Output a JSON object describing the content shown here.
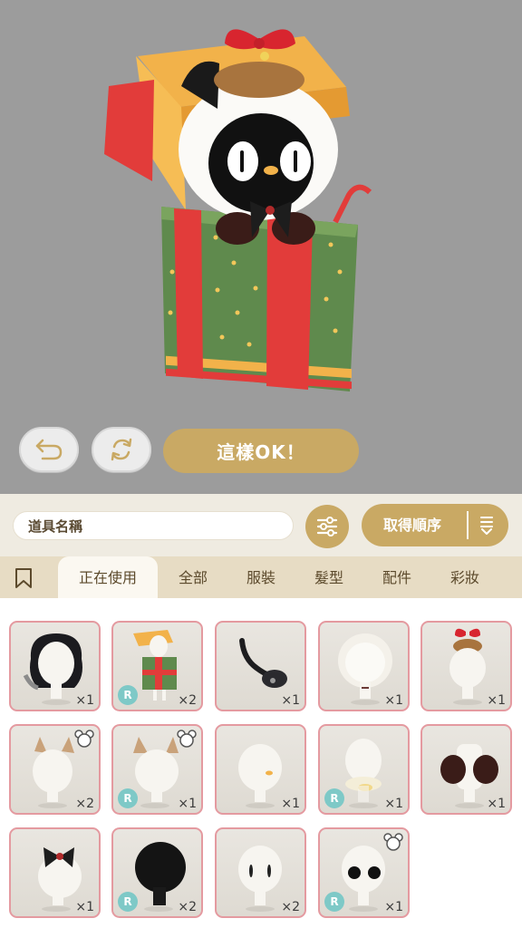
{
  "preview": {
    "ok_label": "這樣OK！"
  },
  "toolbar": {
    "search_placeholder": "道具名稱",
    "sort_label": "取得順序"
  },
  "tabs": [
    {
      "label": "正在使用",
      "active": true
    },
    {
      "label": "全部"
    },
    {
      "label": "服裝"
    },
    {
      "label": "髮型"
    },
    {
      "label": "配件"
    },
    {
      "label": "彩妝"
    }
  ],
  "items": [
    {
      "name": "black-wavy-hair",
      "qty": "×1",
      "rare": false
    },
    {
      "name": "gift-box-outfit",
      "qty": "×2",
      "rare": true
    },
    {
      "name": "tadpole-tail",
      "qty": "×1",
      "rare": false
    },
    {
      "name": "white-lace-bonnet",
      "qty": "×1",
      "rare": false
    },
    {
      "name": "pinecone-bow-hat",
      "qty": "×1",
      "rare": false
    },
    {
      "name": "cat-ears-tan",
      "qty": "×2",
      "rare": false
    },
    {
      "name": "cat-ears-tan-2",
      "qty": "×1",
      "rare": true
    },
    {
      "name": "face-mouth",
      "qty": "×1",
      "rare": false
    },
    {
      "name": "collar-bell",
      "qty": "×1",
      "rare": true
    },
    {
      "name": "fur-muff",
      "qty": "×1",
      "rare": false
    },
    {
      "name": "black-white-bow",
      "qty": "×1",
      "rare": false
    },
    {
      "name": "black-hood",
      "qty": "×2",
      "rare": true
    },
    {
      "name": "slit-eyes",
      "qty": "×2",
      "rare": false
    },
    {
      "name": "round-black-eyes",
      "qty": "×1",
      "rare": true
    }
  ],
  "colors": {
    "gold": "#c9a964",
    "item_border": "#e49aa0",
    "rare_badge": "#7ec9c7"
  }
}
